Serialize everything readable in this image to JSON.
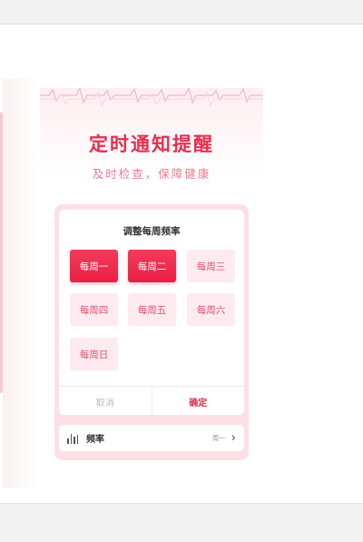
{
  "header": {
    "title": "定时通知提醒",
    "subtitle": "及时检查，保障健康"
  },
  "picker": {
    "title": "调整每周频率",
    "options": [
      {
        "label": "每周一",
        "selected": true
      },
      {
        "label": "每周二",
        "selected": true
      },
      {
        "label": "每周三",
        "selected": false
      },
      {
        "label": "每周四",
        "selected": false
      },
      {
        "label": "每周五",
        "selected": false
      },
      {
        "label": "每周六",
        "selected": false
      },
      {
        "label": "每周日",
        "selected": false
      }
    ],
    "cancel_label": "取消",
    "confirm_label": "确定"
  },
  "frequency": {
    "label": "频率",
    "value": "周一",
    "icon": "bar-chart-icon",
    "arrow_icon": "chevron-right-icon"
  },
  "colors": {
    "accent": "#e8284b",
    "chip_selected": "#f43b5b",
    "chip_unselected_bg": "#fdebef",
    "card_border": "#fde0e6"
  }
}
